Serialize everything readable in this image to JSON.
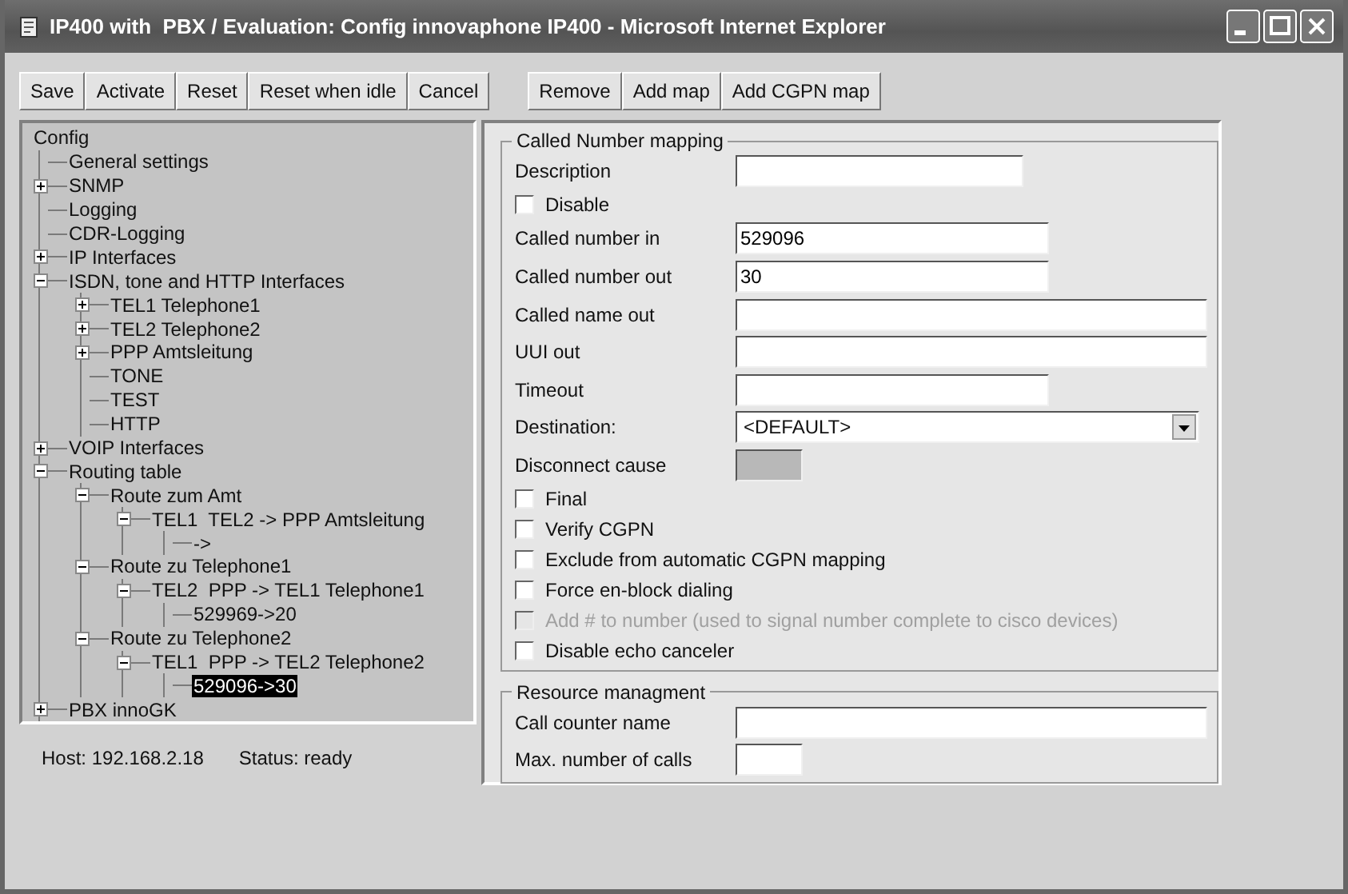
{
  "window": {
    "title": "IP400 with  PBX / Evaluation: Config innovaphone IP400 - Microsoft Internet Explorer"
  },
  "toolbar": {
    "groups": [
      {
        "buttons": [
          "Save",
          "Activate",
          "Reset",
          "Reset when idle",
          "Cancel"
        ]
      },
      {
        "buttons": [
          "Remove",
          "Add map",
          "Add CGPN map"
        ]
      }
    ]
  },
  "tree": {
    "label": "Config",
    "selected": false,
    "children": [
      {
        "label": "General settings",
        "selected": false
      },
      {
        "label": "SNMP",
        "selected": false,
        "expanded": false
      },
      {
        "label": "Logging",
        "selected": false
      },
      {
        "label": "CDR-Logging",
        "selected": false
      },
      {
        "label": "IP Interfaces",
        "selected": false,
        "expanded": false
      },
      {
        "label": "ISDN, tone and HTTP Interfaces",
        "selected": false,
        "expanded": true,
        "children": [
          {
            "label": "TEL1 Telephone1",
            "selected": false,
            "expanded": false
          },
          {
            "label": "TEL2 Telephone2",
            "selected": false,
            "expanded": false
          },
          {
            "label": "PPP Amtsleitung",
            "selected": false,
            "expanded": false
          },
          {
            "label": "TONE",
            "selected": false
          },
          {
            "label": "TEST",
            "selected": false
          },
          {
            "label": "HTTP",
            "selected": false
          }
        ]
      },
      {
        "label": "VOIP Interfaces",
        "selected": false,
        "expanded": false
      },
      {
        "label": "Routing table",
        "selected": false,
        "expanded": true,
        "children": [
          {
            "label": "Route zum Amt",
            "selected": false,
            "expanded": true,
            "children": [
              {
                "label": "TEL1  TEL2 -> PPP Amtsleitung",
                "selected": false,
                "expanded": true,
                "children": [
                  {
                    "label": "->",
                    "selected": false
                  }
                ]
              }
            ]
          },
          {
            "label": "Route zu Telephone1",
            "selected": false,
            "expanded": true,
            "children": [
              {
                "label": "TEL2  PPP -> TEL1 Telephone1",
                "selected": false,
                "expanded": true,
                "children": [
                  {
                    "label": "529969->20",
                    "selected": false
                  }
                ]
              }
            ]
          },
          {
            "label": "Route zu Telephone2",
            "selected": false,
            "expanded": true,
            "children": [
              {
                "label": "TEL1  PPP -> TEL2 Telephone2",
                "selected": false,
                "expanded": true,
                "children": [
                  {
                    "label": "529096->30",
                    "selected": true
                  }
                ]
              }
            ]
          }
        ]
      },
      {
        "label": "PBX innoGK",
        "selected": false,
        "expanded": false
      }
    ]
  },
  "form": {
    "sections": [
      {
        "title": "Called Number mapping",
        "fields": [
          {
            "kind": "text",
            "label": "Description"
          },
          {
            "kind": "checkbox",
            "label": "Disable",
            "checked": false,
            "disabled": false
          },
          {
            "kind": "text",
            "label": "Called number in",
            "value": "529096"
          },
          {
            "kind": "text",
            "label": "Called number out",
            "value": "30"
          },
          {
            "kind": "text",
            "label": "Called name out"
          },
          {
            "kind": "text",
            "label": "UUI out"
          },
          {
            "kind": "text",
            "label": "Timeout"
          },
          {
            "kind": "select",
            "label": "Destination:",
            "value": "<DEFAULT>"
          },
          {
            "kind": "text",
            "label": "Disconnect cause",
            "disabled": true
          },
          {
            "kind": "checkbox",
            "label": "Final",
            "checked": false,
            "disabled": false
          },
          {
            "kind": "checkbox",
            "label": "Verify CGPN",
            "checked": false,
            "disabled": false
          },
          {
            "kind": "checkbox",
            "label": "Exclude from automatic CGPN mapping",
            "checked": false,
            "disabled": false
          },
          {
            "kind": "checkbox",
            "label": "Force en-block dialing",
            "checked": false,
            "disabled": false
          },
          {
            "kind": "checkbox",
            "label": "Add # to number (used to signal number complete to cisco devices)",
            "checked": false,
            "disabled": true
          },
          {
            "kind": "checkbox",
            "label": "Disable echo canceler",
            "checked": false,
            "disabled": false
          }
        ]
      },
      {
        "title": "Resource managment",
        "fields": [
          {
            "kind": "text",
            "label": "Call counter name"
          },
          {
            "kind": "text",
            "label": "Max. number of calls"
          }
        ]
      }
    ]
  },
  "status_bar": {
    "host": "Host: 192.168.2.18",
    "status": "Status: ready"
  }
}
